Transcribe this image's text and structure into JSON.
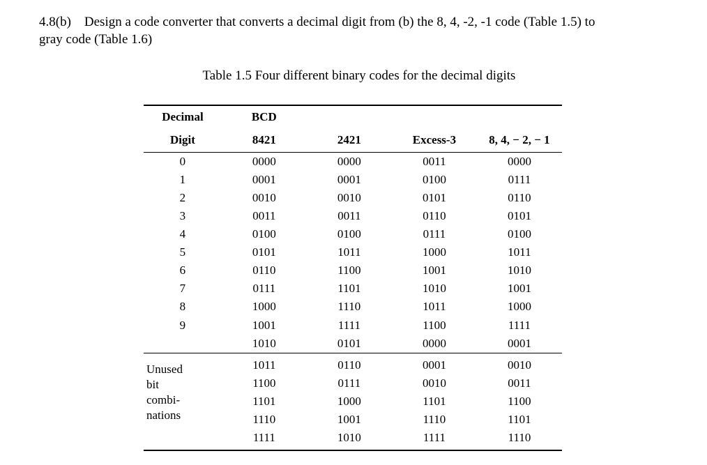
{
  "question": {
    "number": "4.8(b)",
    "text_line1": "Design a code converter that converts a decimal digit from (b) the 8, 4, -2, -1 code (Table 1.5) to",
    "text_line2": "gray code (Table 1.6)"
  },
  "table_caption": "Table 1.5 Four different binary codes for the decimal digits",
  "headers": {
    "col1a": "Decimal",
    "col1b": "Digit",
    "col2a": "BCD",
    "col2b": "8421",
    "col3": "2421",
    "col4": "Excess-3",
    "col5": "8, 4, − 2, − 1"
  },
  "rows_valid": [
    {
      "digit": "0",
      "bcd": "0000",
      "c2421": "0000",
      "ex3": "0011",
      "c84m2m1": "0000"
    },
    {
      "digit": "1",
      "bcd": "0001",
      "c2421": "0001",
      "ex3": "0100",
      "c84m2m1": "0111"
    },
    {
      "digit": "2",
      "bcd": "0010",
      "c2421": "0010",
      "ex3": "0101",
      "c84m2m1": "0110"
    },
    {
      "digit": "3",
      "bcd": "0011",
      "c2421": "0011",
      "ex3": "0110",
      "c84m2m1": "0101"
    },
    {
      "digit": "4",
      "bcd": "0100",
      "c2421": "0100",
      "ex3": "0111",
      "c84m2m1": "0100"
    },
    {
      "digit": "5",
      "bcd": "0101",
      "c2421": "1011",
      "ex3": "1000",
      "c84m2m1": "1011"
    },
    {
      "digit": "6",
      "bcd": "0110",
      "c2421": "1100",
      "ex3": "1001",
      "c84m2m1": "1010"
    },
    {
      "digit": "7",
      "bcd": "0111",
      "c2421": "1101",
      "ex3": "1010",
      "c84m2m1": "1001"
    },
    {
      "digit": "8",
      "bcd": "1000",
      "c2421": "1110",
      "ex3": "1011",
      "c84m2m1": "1000"
    },
    {
      "digit": "9",
      "bcd": "1001",
      "c2421": "1111",
      "ex3": "1100",
      "c84m2m1": "1111"
    }
  ],
  "unused_label_lines": [
    "Unused",
    "bit",
    "combi-",
    "nations"
  ],
  "rows_unused": [
    {
      "bcd": "1010",
      "c2421": "0101",
      "ex3": "0000",
      "c84m2m1": "0001"
    },
    {
      "bcd": "1011",
      "c2421": "0110",
      "ex3": "0001",
      "c84m2m1": "0010"
    },
    {
      "bcd": "1100",
      "c2421": "0111",
      "ex3": "0010",
      "c84m2m1": "0011"
    },
    {
      "bcd": "1101",
      "c2421": "1000",
      "ex3": "1101",
      "c84m2m1": "1100"
    },
    {
      "bcd": "1110",
      "c2421": "1001",
      "ex3": "1110",
      "c84m2m1": "1101"
    },
    {
      "bcd": "1111",
      "c2421": "1010",
      "ex3": "1111",
      "c84m2m1": "1110"
    }
  ]
}
